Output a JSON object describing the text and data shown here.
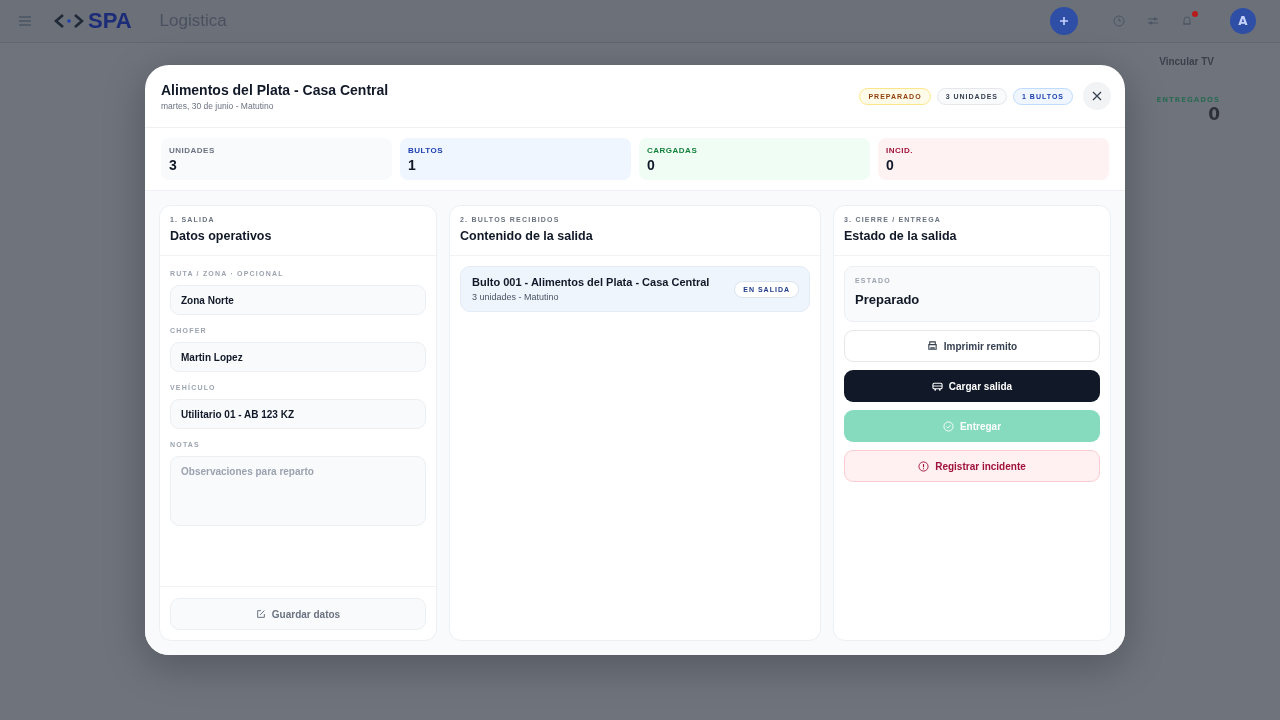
{
  "app": {
    "brand": "SPA",
    "section": "Logistica",
    "avatar": "A",
    "notifications": true,
    "tv_button": "Vincular TV",
    "stat": {
      "label": "ENTREGADOS",
      "value": "0"
    }
  },
  "modal": {
    "title": "Alimentos del Plata - Casa Central",
    "subtitle": "martes, 30 de junio - Matutino",
    "badges": [
      {
        "label": "PREPARADO",
        "kind": "warning"
      },
      {
        "label": "3 UNIDADES",
        "kind": "neutral"
      },
      {
        "label": "1 BULTOS",
        "kind": "info"
      }
    ],
    "stats": [
      {
        "label": "UNIDADES",
        "value": "3",
        "kind": "neutral"
      },
      {
        "label": "BULTOS",
        "value": "1",
        "kind": "info"
      },
      {
        "label": "CARGADAS",
        "value": "0",
        "kind": "success"
      },
      {
        "label": "INCID.",
        "value": "0",
        "kind": "danger"
      }
    ],
    "departure": {
      "step": "1. SALIDA",
      "title": "Datos operativos",
      "fields": [
        {
          "label": "RUTA / ZONA · OPCIONAL",
          "value": "Zona Norte",
          "kind": "input"
        },
        {
          "label": "CHOFER",
          "value": "Martin Lopez",
          "kind": "input"
        },
        {
          "label": "VEHÍCULO",
          "value": "Utilitario 01 - AB 123 KZ",
          "kind": "input"
        },
        {
          "label": "NOTAS",
          "placeholder": "Observaciones para reparto",
          "kind": "textarea"
        }
      ],
      "save_button": {
        "label": "Guardar datos",
        "disabled": true
      }
    },
    "contents": {
      "step": "2. BULTOS RECIBIDOS",
      "title": "Contenido de la salida",
      "items": [
        {
          "title": "Bulto 001 - Alimentos del Plata - Casa Central",
          "meta": "3 unidades - Matutino",
          "badge": "EN SALIDA"
        }
      ]
    },
    "closing": {
      "step": "3. CIERRE / ENTREGA",
      "title": "Estado de la salida",
      "status": {
        "label": "ESTADO",
        "value": "Preparado"
      },
      "actions": [
        {
          "label": "Imprimir remito",
          "kind": "outline",
          "disabled": false
        },
        {
          "label": "Cargar salida",
          "kind": "primary",
          "disabled": false
        },
        {
          "label": "Entregar",
          "kind": "success",
          "disabled": true
        },
        {
          "label": "Registrar incidente",
          "kind": "danger",
          "disabled": false
        }
      ]
    }
  }
}
